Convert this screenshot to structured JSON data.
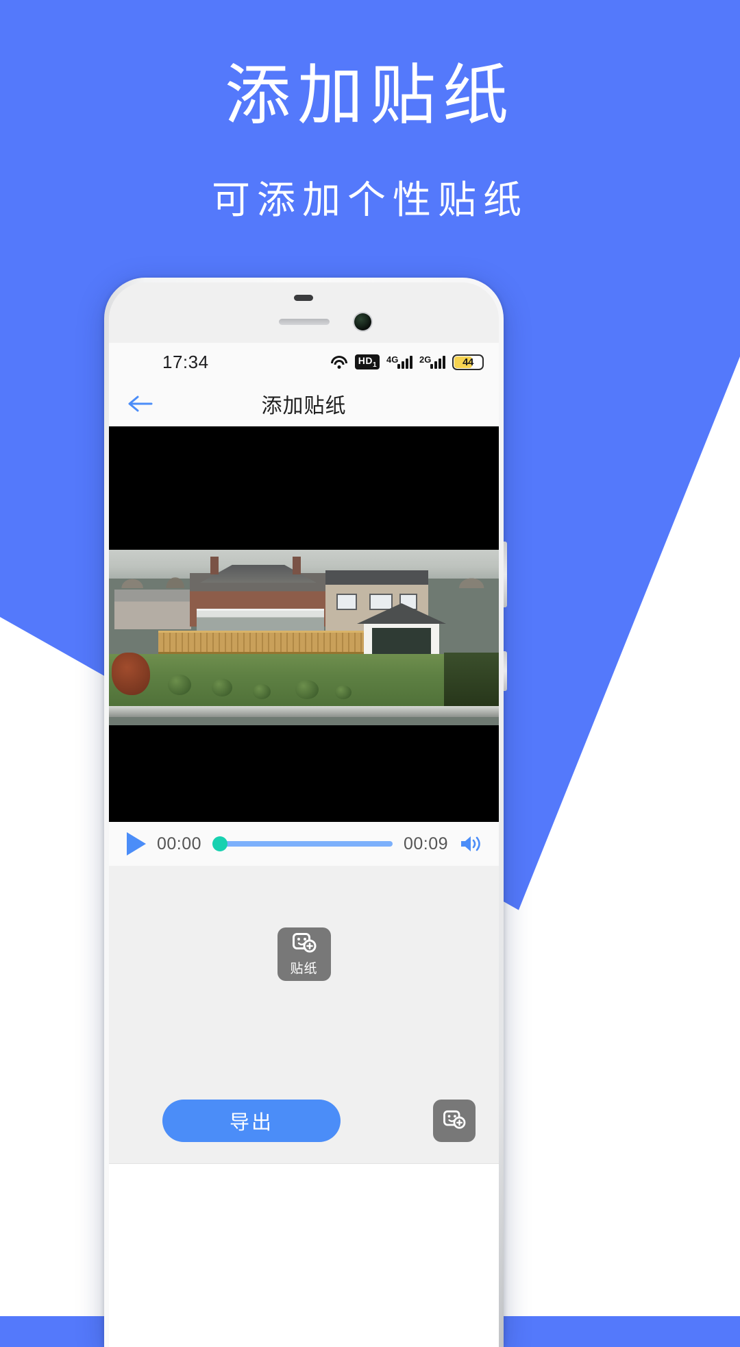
{
  "promo": {
    "title": "添加贴纸",
    "subtitle": "可添加个性贴纸",
    "background_color": "#5479fb",
    "text_color": "#ffffff"
  },
  "phone": {
    "status_bar": {
      "time": "17:34",
      "wifi_icon": "wifi-icon",
      "hd_label": "HD",
      "hd_sub": "1",
      "signal_1_label": "4G",
      "signal_2_label": "2G",
      "battery_percent": "44",
      "battery_fill_color": "#f6d351"
    },
    "app_header": {
      "back_icon": "back-arrow-icon",
      "title": "添加贴纸",
      "accent_color": "#4b8df8"
    },
    "player": {
      "play_icon": "play-icon",
      "current_time": "00:00",
      "total_time": "00:09",
      "volume_icon": "volume-icon",
      "progress_percent": 0,
      "track_color": "#7cb0fb",
      "thumb_color": "#18d1b0"
    },
    "editor": {
      "sticker_tool": {
        "icon": "sticker-add-icon",
        "label": "贴纸"
      }
    },
    "actions": {
      "export_label": "导出",
      "export_color": "#4b8df8",
      "sticker_fab_icon": "sticker-add-icon"
    }
  }
}
